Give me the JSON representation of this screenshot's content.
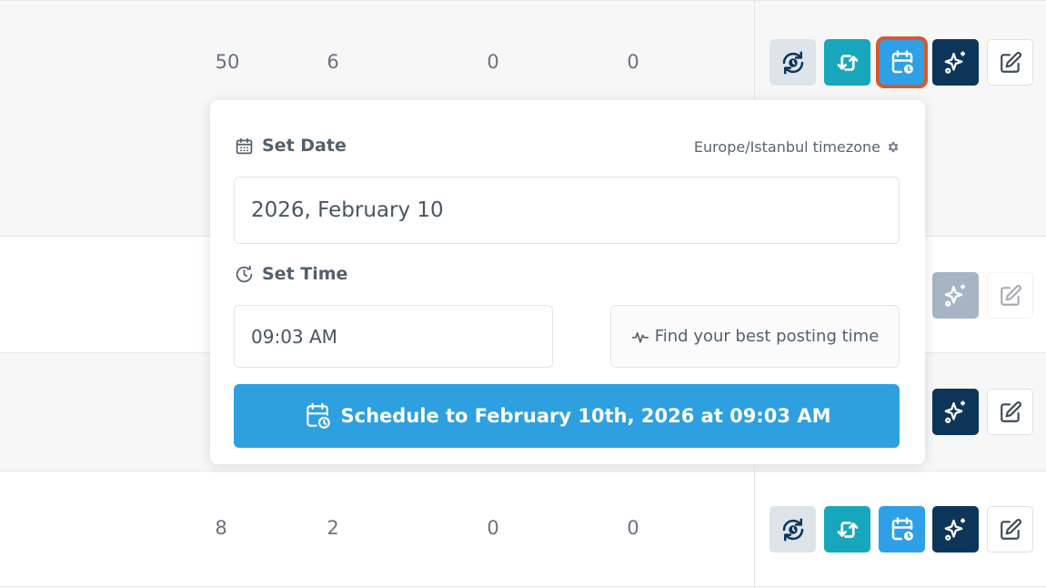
{
  "rows": [
    {
      "c1": "50",
      "c2": "6",
      "c3": "0",
      "c4": "0"
    },
    {
      "c1": "8",
      "c2": "2",
      "c3": "0",
      "c4": "0"
    }
  ],
  "popover": {
    "date_label": "Set Date",
    "timezone": "Europe/Istanbul timezone",
    "date_value": "2026, February 10",
    "time_label": "Set Time",
    "time_value": "09:03 AM",
    "best_time_label": "Find your best posting time",
    "schedule_label": "Schedule to February 10th, 2026 at 09:03 AM"
  },
  "icons": {
    "sync": "refresh-clock-icon",
    "repeat": "repeat-icon",
    "schedule": "calendar-clock-icon",
    "ai": "sparkles-icon",
    "edit": "edit-icon",
    "date": "calendar-icon",
    "time": "clock-icon",
    "gear": "gear-icon",
    "pulse": "pulse-icon"
  },
  "colors": {
    "repeat": "#17a7bd",
    "schedule": "#2ea0e8",
    "ai": "#0c3559",
    "active_outline": "#d9582b",
    "schedule_button": "#2ea0e0"
  }
}
